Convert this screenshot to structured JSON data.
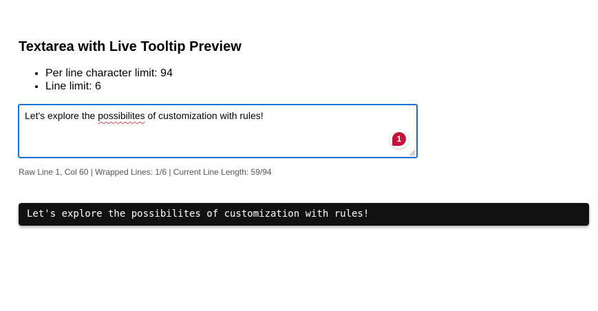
{
  "page": {
    "title": "Textarea with Live Tooltip Preview"
  },
  "limits": {
    "items": [
      {
        "label": "Per line character limit: 94"
      },
      {
        "label": "Line limit: 6"
      }
    ]
  },
  "editor": {
    "text_before": "Let's explore the ",
    "misspelled_word": "possibilites",
    "text_after": " of customization with rules!",
    "grammar_issue_count": "1",
    "focus_border_color": "#1a6fd8",
    "badge_color": "#c6123a",
    "spellcheck_underline_color": "#e1465a"
  },
  "status": {
    "text": "Raw Line 1, Col 60 | Wrapped Lines: 1/6 | Current Line Length: 59/94"
  },
  "tooltip": {
    "preview_text": "Let's explore the possibilites of customization with rules!",
    "background_color": "#111111"
  },
  "icons": {
    "grammar_badge": "grammar-checker-icon",
    "resize": "resize-grip-icon"
  }
}
